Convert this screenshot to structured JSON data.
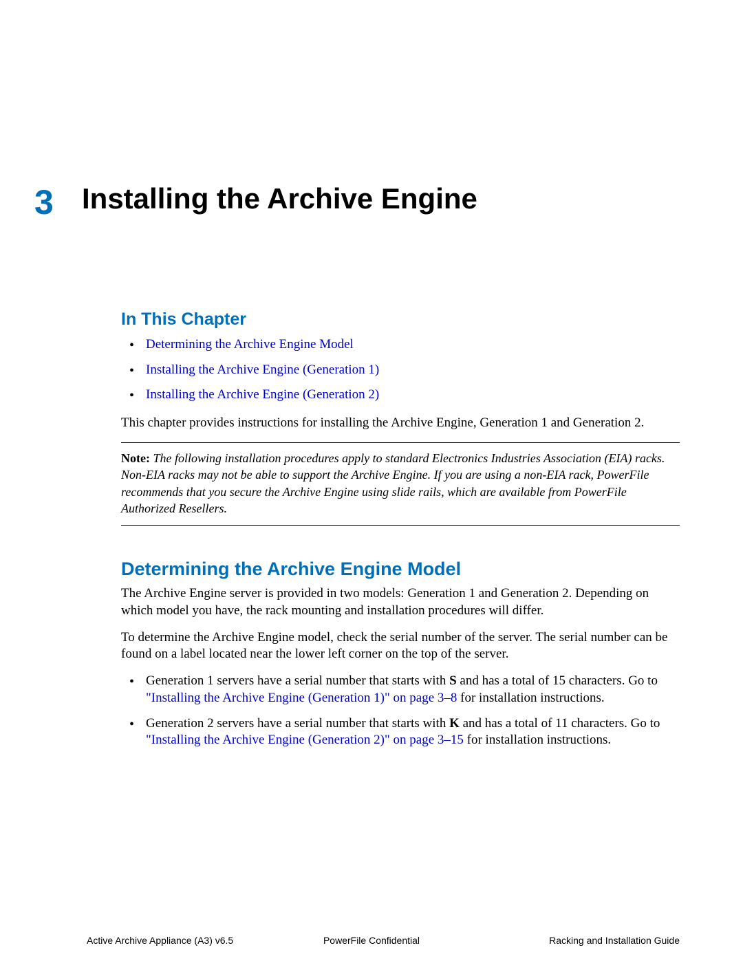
{
  "chapter": {
    "number": "3",
    "title": "Installing the Archive Engine"
  },
  "sections": {
    "in_this_chapter": {
      "heading": "In This Chapter",
      "links": [
        "Determining the Archive Engine Model",
        "Installing the Archive Engine (Generation 1)",
        "Installing the Archive Engine (Generation 2)"
      ],
      "intro_text": "This chapter provides instructions for installing the Archive Engine, Generation 1 and Generation 2."
    },
    "note": {
      "label": "Note:",
      "text": "The following installation procedures apply to standard Electronics Industries Association (EIA) racks. Non-EIA racks may not be able to support the Archive Engine. If you are using a non-EIA rack, PowerFile recommends that you secure the Archive Engine using slide rails, which are available from PowerFile Authorized Resellers."
    },
    "determining": {
      "heading": "Determining the Archive Engine Model",
      "p1": "The Archive Engine server is provided in two models: Generation 1 and Generation 2. Depending on which model you have, the rack mounting and installation procedures will differ.",
      "p2": "To determine the Archive Engine model, check the serial number of the server. The serial number can be found on a label located near the lower left corner on the top of the server.",
      "bullets": {
        "b1_pre": "Generation 1 servers have a serial number that starts with ",
        "b1_bold": "S",
        "b1_mid": " and has a total of 15 characters. Go to ",
        "b1_link": "\"Installing the Archive Engine (Generation 1)\" on page 3–8",
        "b1_post": " for installation instructions.",
        "b2_pre": "Generation 2 servers have a serial number that starts with ",
        "b2_bold": "K",
        "b2_mid": " and has a total of 11 characters. Go to ",
        "b2_link": "\"Installing the Archive Engine (Generation 2)\" on page 3–15",
        "b2_post": " for installation instructions."
      }
    }
  },
  "footer": {
    "left": "Active Archive Appliance (A3) v6.5",
    "center": "PowerFile Confidential",
    "right": "Racking and Installation Guide"
  }
}
